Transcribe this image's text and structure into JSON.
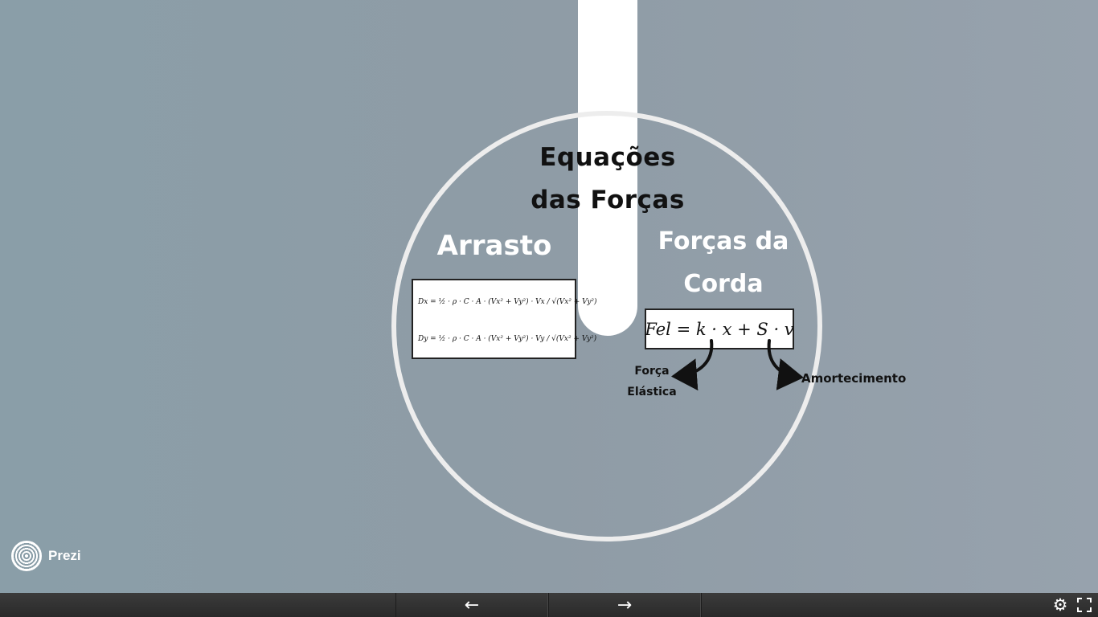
{
  "slide": {
    "title_line1": "Equações",
    "title_line2": "das Forças",
    "drag_heading": "Arrasto",
    "rope_heading_line1": "Forças da",
    "rope_heading_line2": "Corda",
    "drag_eq_x": "Dx = ½ · ρ · C · A · (Vx² + Vy²) · Vx / √(Vx² + Vy²)",
    "drag_eq_y": "Dy = ½ · ρ · C · A · (Vx² + Vy²) · Vy / √(Vx² + Vy²)",
    "rope_eq": "Fel = k · x + S · v",
    "label_elastic_line1": "Força",
    "label_elastic_line2": "Elástica",
    "label_damping": "Amortecimento"
  },
  "branding": {
    "logo_text": "Prezi"
  },
  "controls": {
    "prev_icon": "arrow-left-icon",
    "next_icon": "arrow-right-icon",
    "prev_glyph": "←",
    "next_glyph": "→",
    "settings_icon": "gear-icon",
    "fullscreen_icon": "fullscreen-icon"
  },
  "colors": {
    "background": "#8f9ca6",
    "ring": "#ededed",
    "pillar": "#ffffff",
    "toolbar": "#333333"
  }
}
